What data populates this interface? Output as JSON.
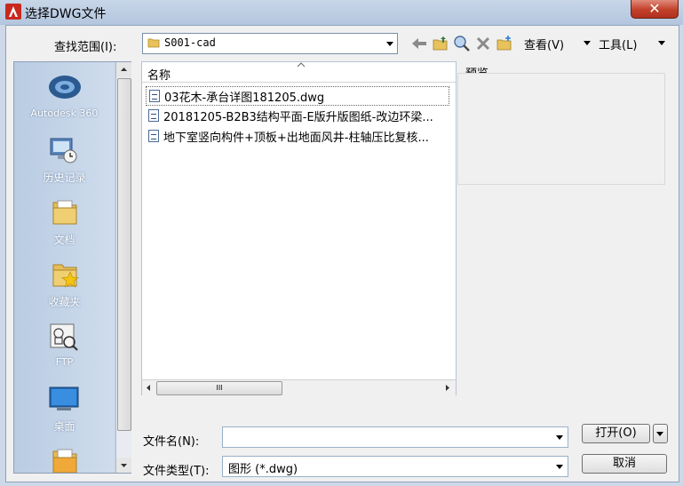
{
  "window": {
    "title": "选择DWG文件",
    "close_glyph": "✕"
  },
  "lookin": {
    "label": "查找范围(I):",
    "value": "S001-cad"
  },
  "toolbar": {
    "view_label": "查看(V)",
    "tools_label": "工具(L)"
  },
  "places": [
    {
      "label": "Autodesk 360",
      "icon": "autodesk-360-icon"
    },
    {
      "label": "历史记录",
      "icon": "history-icon"
    },
    {
      "label": "文档",
      "icon": "documents-folder-icon"
    },
    {
      "label": "收藏夹",
      "icon": "favorites-folder-icon"
    },
    {
      "label": "FTP",
      "icon": "ftp-icon"
    },
    {
      "label": "桌面",
      "icon": "desktop-icon"
    }
  ],
  "filelist": {
    "column_name": "名称",
    "files": [
      "03花木-承台详图181205.dwg",
      "20181205-B2B3结构平面-E版升版图纸-改边环梁...",
      "地下室竖向构件+顶板+出地面风井-柱轴压比复核..."
    ],
    "hscroll_grip": "III"
  },
  "preview": {
    "label": "预览"
  },
  "bottom": {
    "filename_label": "文件名(N):",
    "filename_value": "",
    "filetype_label": "文件类型(T):",
    "filetype_value": "图形 (*.dwg)",
    "open_label": "打开(O)",
    "cancel_label": "取消"
  },
  "colors": {
    "accent_red": "#c2402a",
    "places_bg": "#c3d3e6"
  }
}
